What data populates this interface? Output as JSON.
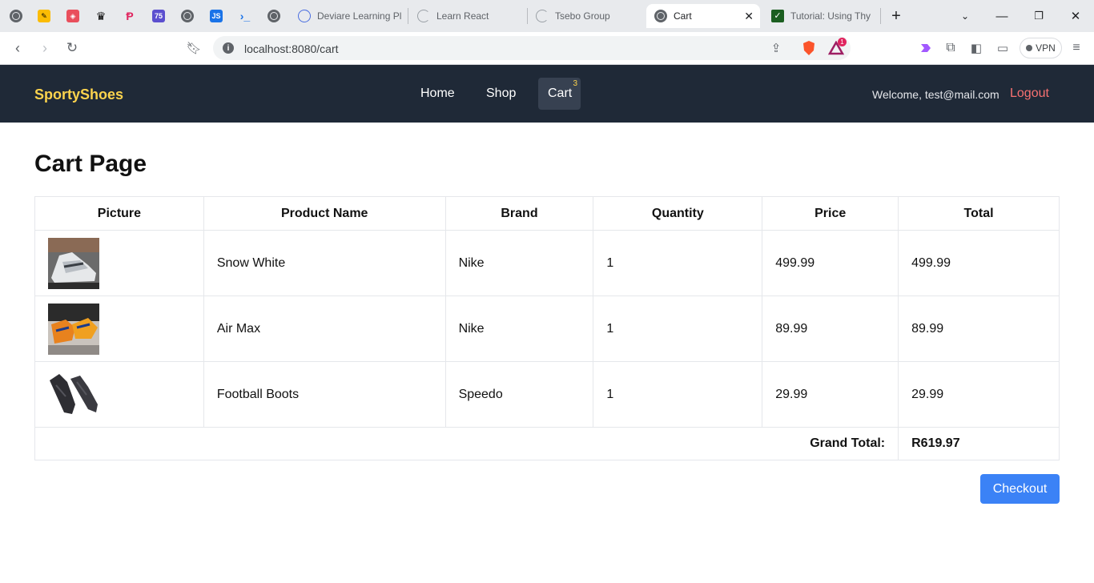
{
  "browser": {
    "tabs": [
      {
        "title": "Deviare Learning Pl",
        "icon": "circle-s-icon"
      },
      {
        "title": "Learn React",
        "icon": "loading-icon"
      },
      {
        "title": "Tsebo Group",
        "icon": "loading-icon"
      },
      {
        "title": "Cart",
        "icon": "globe-icon",
        "active": true
      },
      {
        "title": "Tutorial: Using Thy",
        "icon": "check-square-icon"
      }
    ],
    "pinned_labels": {
      "calendar": "75",
      "js": "JS"
    },
    "url": "localhost:8080/cart",
    "vpn_label": "VPN",
    "notification_count": "1"
  },
  "site": {
    "brand": "SportyShoes",
    "nav": {
      "home": "Home",
      "shop": "Shop",
      "cart": "Cart",
      "cart_count": "3"
    },
    "welcome": "Welcome, test@mail.com",
    "logout": "Logout",
    "colors": {
      "navbar": "#1f2937",
      "brand": "#fcd34d",
      "logout": "#f87171",
      "checkout": "#3b82f6"
    }
  },
  "page": {
    "title": "Cart Page",
    "table": {
      "headers": [
        "Picture",
        "Product Name",
        "Brand",
        "Quantity",
        "Price",
        "Total"
      ],
      "rows": [
        {
          "name": "Snow White",
          "brand": "Nike",
          "quantity": "1",
          "price": "499.99",
          "total": "499.99",
          "image": "white-sneaker"
        },
        {
          "name": "Air Max",
          "brand": "Nike",
          "quantity": "1",
          "price": "89.99",
          "total": "89.99",
          "image": "orange-sneaker"
        },
        {
          "name": "Football Boots",
          "brand": "Speedo",
          "quantity": "1",
          "price": "29.99",
          "total": "29.99",
          "image": "black-boots"
        }
      ],
      "grand_total_label": "Grand Total:",
      "grand_total_value": "R619.97"
    },
    "checkout_label": "Checkout"
  }
}
